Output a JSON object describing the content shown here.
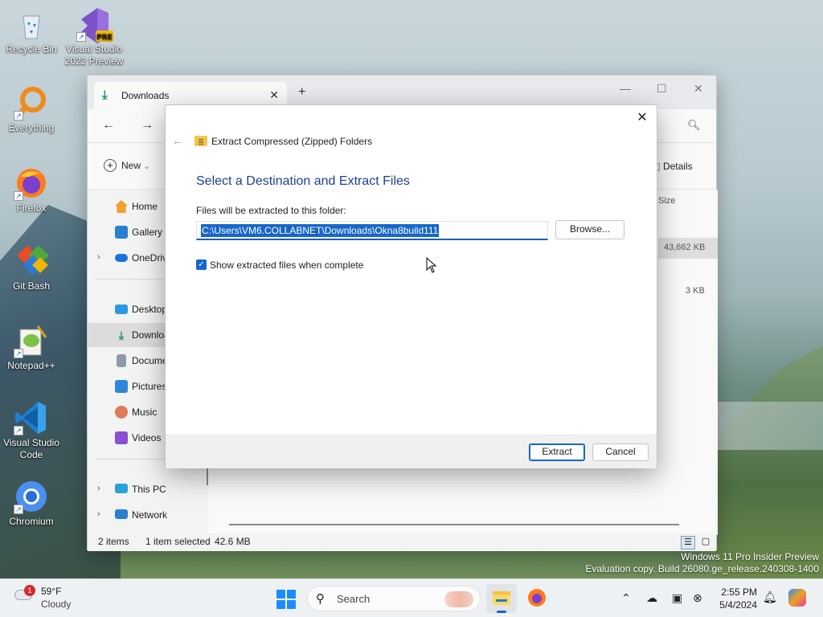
{
  "desktop": {
    "icons": [
      {
        "label": "Recycle Bin"
      },
      {
        "label": "Visual Studio 2022 Preview",
        "badge": "PRE"
      },
      {
        "label": "Everything"
      },
      {
        "label": "Firefox"
      },
      {
        "label": "Git Bash"
      },
      {
        "label": "Notepad++"
      },
      {
        "label": "Visual Studio Code"
      },
      {
        "label": "Chromium"
      }
    ]
  },
  "explorer": {
    "tab_title": "Downloads",
    "toolbar": {
      "new_label": "New",
      "details_label": "Details"
    },
    "sidebar": [
      {
        "label": "Home"
      },
      {
        "label": "Gallery"
      },
      {
        "label": "OneDrive"
      },
      {
        "label": "Desktop"
      },
      {
        "label": "Downloads"
      },
      {
        "label": "Documents"
      },
      {
        "label": "Pictures"
      },
      {
        "label": "Music"
      },
      {
        "label": "Videos"
      },
      {
        "label": "This PC"
      },
      {
        "label": "Network"
      }
    ],
    "content": {
      "size_header": "Size",
      "sizes": [
        "43,662 KB",
        "3 KB"
      ]
    },
    "status": {
      "item_count": "2 items",
      "selection": "1 item selected",
      "selection_size": "42.6 MB"
    }
  },
  "dialog": {
    "title": "Extract Compressed (Zipped) Folders",
    "heading": "Select a Destination and Extract Files",
    "prompt": "Files will be extracted to this folder:",
    "path_value": "C:\\Users\\VM6.COLLABNET\\Downloads\\Okna8build111",
    "browse_label": "Browse...",
    "checkbox_label": "Show extracted files when complete",
    "checkbox_checked": true,
    "extract_label": "Extract",
    "cancel_label": "Cancel"
  },
  "watermark": {
    "line1": "Windows 11 Pro Insider Preview",
    "line2": "Evaluation copy. Build 26080.ge_release.240308-1400"
  },
  "taskbar": {
    "weather_badge": "1",
    "temperature": "59°F",
    "condition": "Cloudy",
    "search_placeholder": "Search",
    "time": "2:55 PM",
    "date": "5/4/2024"
  },
  "colors": {
    "accent": "#1667c8",
    "dialog_heading": "#1f3f8f",
    "downloads_green": "#1a8f6a"
  }
}
